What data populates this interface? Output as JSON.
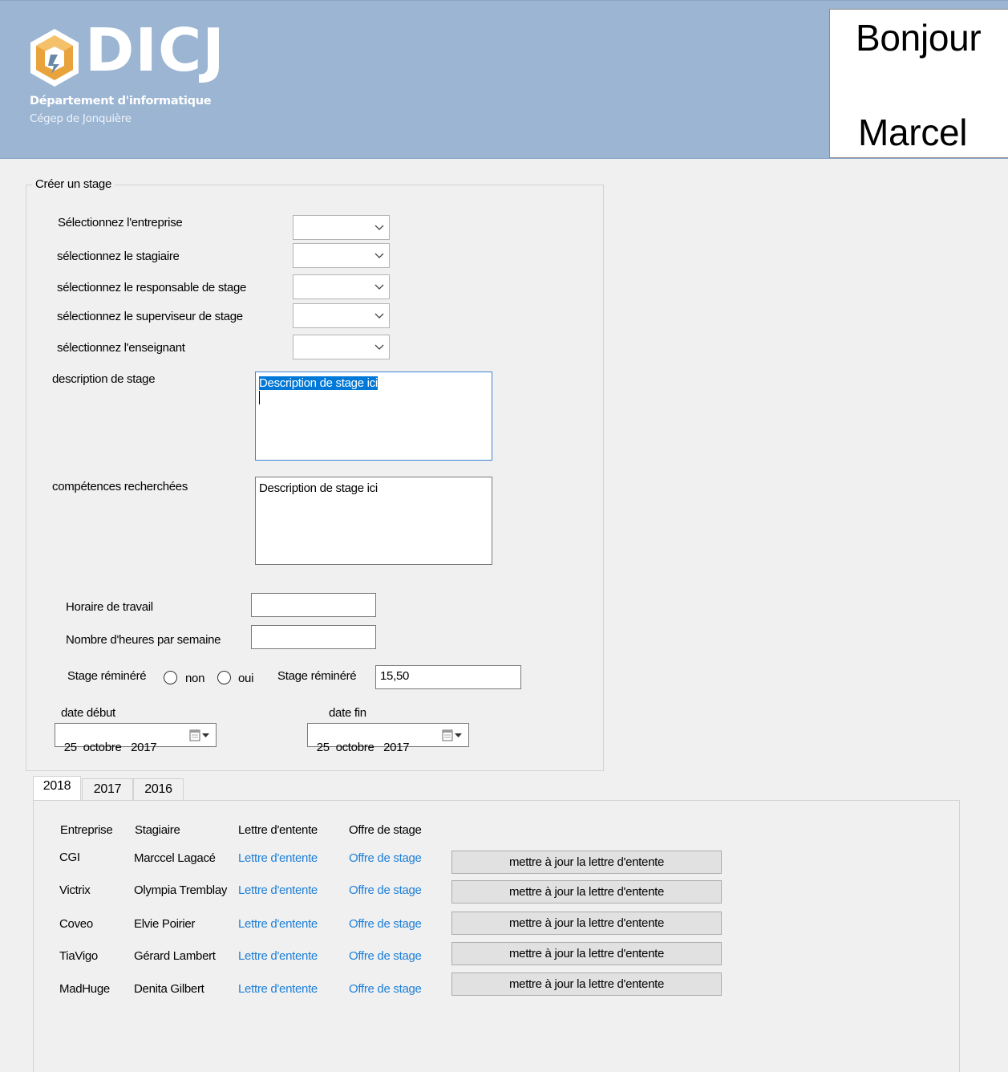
{
  "header": {
    "logo_text": "DICJ",
    "department": "Département d'informatique",
    "college": "Cégep de Jonquière",
    "greeting_line1": "Bonjour",
    "greeting_line2": "Marcel"
  },
  "form": {
    "group_title": "Créer un stage",
    "labels": {
      "entreprise": "Sélectionnez l'entreprise",
      "stagiaire": "sélectionnez le stagiaire",
      "responsable": "sélectionnez le responsable de stage",
      "superviseur": "sélectionnez le superviseur de stage",
      "enseignant": "sélectionnez l'enseignant",
      "description": "description de stage",
      "competences": "compétences recherchées",
      "horaire": "Horaire  de travail",
      "heures": "Nombre d'heures par semaine",
      "remunere": "Stage réminéré",
      "radio_non": "non",
      "radio_oui": "oui",
      "remunere_amount": "Stage réminéré",
      "date_debut": "date début",
      "date_fin": "date fin"
    },
    "values": {
      "entreprise": "",
      "stagiaire": "",
      "responsable": "",
      "superviseur": "",
      "enseignant": "",
      "description": "Description de stage ici",
      "competences": "Description de stage ici",
      "horaire": "",
      "heures": "",
      "remunere_amount": "15,50",
      "date_debut": "25  octobre   2017",
      "date_fin": "25  octobre   2017"
    }
  },
  "tabs": [
    "2018",
    "2017",
    "2016"
  ],
  "table": {
    "headers": [
      "Entreprise",
      "Stagiaire",
      "Lettre d'entente",
      "Offre de stage"
    ],
    "rows": [
      {
        "entreprise": "CGI",
        "stagiaire": "Marccel Lagacé",
        "lettre": "Lettre d'entente",
        "offre": "Offre de stage",
        "button": "mettre à jour la lettre d'entente"
      },
      {
        "entreprise": "Victrix",
        "stagiaire": "Olympia Tremblay",
        "lettre": "Lettre d'entente",
        "offre": "Offre de stage",
        "button": "mettre à jour la lettre d'entente"
      },
      {
        "entreprise": "Coveo",
        "stagiaire": "Elvie Poirier",
        "lettre": "Lettre d'entente",
        "offre": "Offre de stage",
        "button": "mettre à jour la lettre d'entente"
      },
      {
        "entreprise": "TiaVigo",
        "stagiaire": "Gérard Lambert",
        "lettre": "Lettre d'entente",
        "offre": "Offre de stage",
        "button": "mettre à jour la lettre d'entente"
      },
      {
        "entreprise": "MadHuge",
        "stagiaire": "Denita Gilbert",
        "lettre": "Lettre d'entente",
        "offre": "Offre de stage",
        "button": "mettre à jour la lettre d'entente"
      }
    ]
  },
  "colors": {
    "header_bg": "#9bb5d3",
    "link": "#1e7fd8",
    "selection": "#0078d7"
  }
}
